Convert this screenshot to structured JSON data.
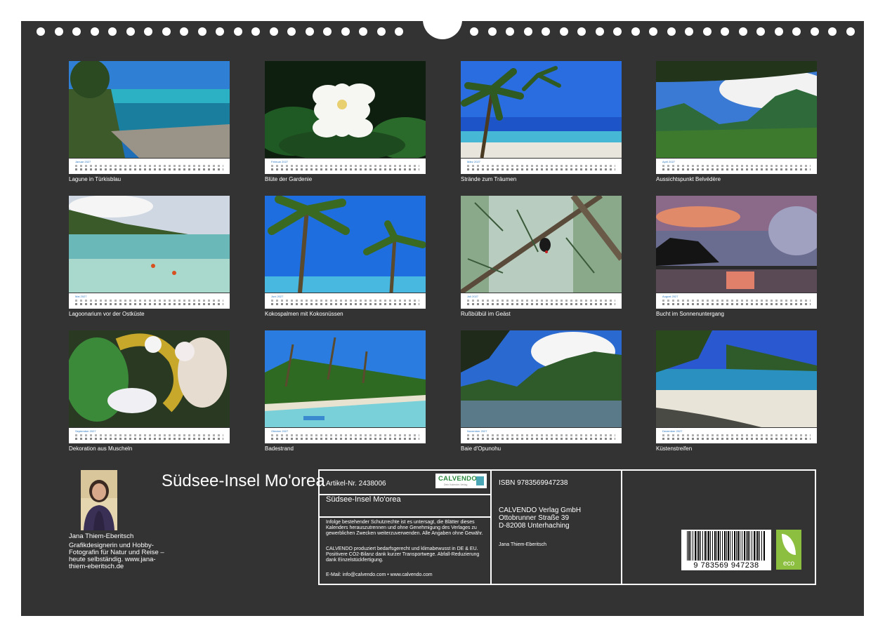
{
  "months": [
    {
      "month": "Januar 2027",
      "caption": "Lagune in Türkisblau",
      "scene": "lagoon-icon"
    },
    {
      "month": "Februar 2027",
      "caption": "Blüte der Gardenie",
      "scene": "gardenia-icon"
    },
    {
      "month": "März 2027",
      "caption": "Strände zum Träumen",
      "scene": "palm-beach-icon"
    },
    {
      "month": "April 2027",
      "caption": "Aussichtspunkt Belvédère",
      "scene": "mountain-view-icon"
    },
    {
      "month": "Mai 2027",
      "caption": "Lagoonarium vor der Ostküste",
      "scene": "lagoonarium-icon"
    },
    {
      "month": "Juni 2027",
      "caption": "Kokospalmen mit Kokosnüssen",
      "scene": "coconut-palms-icon"
    },
    {
      "month": "Juli 2027",
      "caption": "Rußbülbül im Geäst",
      "scene": "bird-icon"
    },
    {
      "month": "August 2027",
      "caption": "Bucht im Sonnenuntergang",
      "scene": "sunset-icon"
    },
    {
      "month": "September 2027",
      "caption": "Dekoration aus Muscheln",
      "scene": "shells-icon"
    },
    {
      "month": "Oktober 2027",
      "caption": "Badestrand",
      "scene": "bathing-beach-icon"
    },
    {
      "month": "November 2027",
      "caption": "Baie d'Opunohu",
      "scene": "bay-icon"
    },
    {
      "month": "Dezember 2027",
      "caption": "Küstenstreifen",
      "scene": "coast-icon"
    }
  ],
  "title": "Südsee-Insel Mo'orea",
  "author": {
    "name": "Jana Thiem-Eberitsch",
    "bio": "Grafikdesignerin und Hobby-Fotografin für Natur und Reise – heute selbständig. www.jana-thiem-eberitsch.de"
  },
  "info": {
    "article": "Artikel-Nr. 2438006",
    "title": "Südsee-Insel Mo'orea",
    "legal": "Infolge bestehender Schutzrechte ist es untersagt, die Blätter dieses Kalenders herauszutrennen und ohne Genehmigung des Verlages zu gewerblichen Zwecken weiterzuverwenden. Alle Angaben ohne Gewähr.",
    "eco_note": "CALVENDO produziert bedarfsgerecht und klimabewusst in DE & EU. Positivere CO2-Bilanz dank kurzer Transportwege. Abfall-Reduzierung dank Einzelstückfertigung.",
    "contact": "E-Mail: info@calvendo.com • www.calvendo.com",
    "isbn": "ISBN 9783569947238",
    "publisher": "CALVENDO Verlag GmbH",
    "street": "Ottobrunner Straße 39",
    "city": "D-82008 Unterhaching",
    "author_small": "Jana Thiem-Eberitsch",
    "barcode": "9 783569 947238",
    "logo": "CALVENDO",
    "logo_tag": "Dein Kalender-Verlag",
    "eco": "eco"
  },
  "colors": {
    "background": "#333333",
    "accent": "#2a78c2",
    "eco": "#8cbf3f"
  }
}
